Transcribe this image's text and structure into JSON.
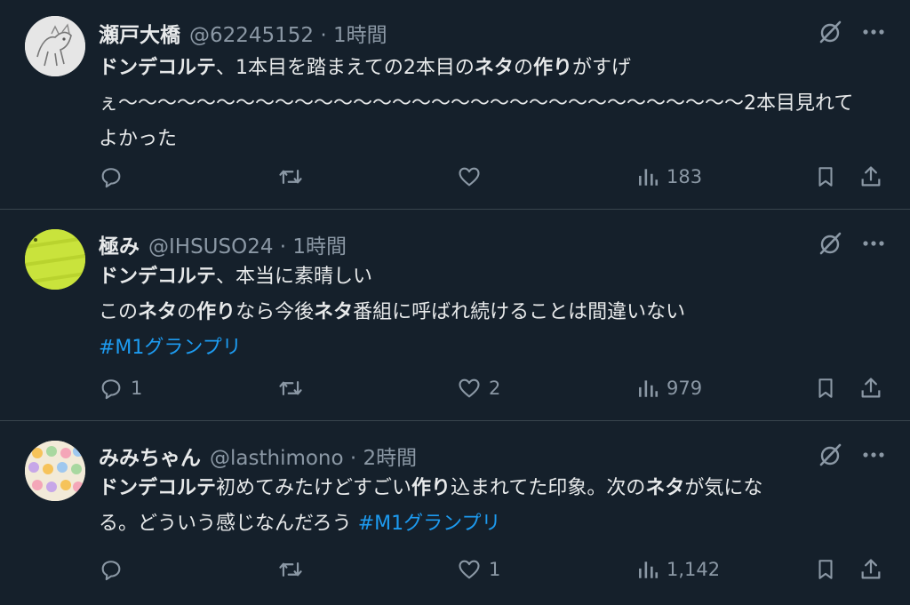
{
  "tweets": [
    {
      "name": "瀬戸大橋",
      "handle": "@62245152",
      "time": "1時間",
      "lines": [
        [
          {
            "t": "ドンデコルテ",
            "b": true
          },
          {
            "t": "、1本目を踏まえての2本目の"
          },
          {
            "t": "ネタ",
            "b": true
          },
          {
            "t": "の"
          },
          {
            "t": "作り",
            "b": true
          },
          {
            "t": "がすげ"
          }
        ],
        [
          {
            "t": "ぇ〜〜〜〜〜〜〜〜〜〜〜〜〜〜〜〜〜〜〜〜〜〜〜〜〜〜〜〜〜〜〜〜2本目見れて"
          }
        ],
        [
          {
            "t": "よかった"
          }
        ]
      ],
      "replies": "",
      "retweets": "",
      "likes": "",
      "views": "183"
    },
    {
      "name": "極み",
      "handle": "@IHSUSO24",
      "time": "1時間",
      "lines": [
        [
          {
            "t": "ドンデコルテ",
            "b": true
          },
          {
            "t": "、本当に素晴しい"
          }
        ],
        [
          {
            "t": "この"
          },
          {
            "t": "ネタ",
            "b": true
          },
          {
            "t": "の"
          },
          {
            "t": "作り",
            "b": true
          },
          {
            "t": "なら今後"
          },
          {
            "t": "ネタ",
            "b": true
          },
          {
            "t": "番組に呼ばれ続けることは間違いない"
          }
        ],
        [
          {
            "t": "#M1グランプリ",
            "tag": true
          }
        ]
      ],
      "replies": "1",
      "retweets": "",
      "likes": "2",
      "views": "979"
    },
    {
      "name": "みみちゃん",
      "handle": "@lasthimono",
      "time": "2時間",
      "lines": [
        [
          {
            "t": "ドンデコルテ",
            "b": true
          },
          {
            "t": "初めてみたけどすごい"
          },
          {
            "t": "作り",
            "b": true
          },
          {
            "t": "込まれてた印象。次の"
          },
          {
            "t": "ネタ",
            "b": true
          },
          {
            "t": "が気にな"
          }
        ],
        [
          {
            "t": "る。どういう感じなんだろう "
          },
          {
            "t": "#M1グランプリ",
            "tag": true
          }
        ]
      ],
      "replies": "",
      "retweets": "",
      "likes": "1",
      "views": "1,142"
    }
  ],
  "icons": {
    "reply": "reply-icon",
    "retweet": "retweet-icon",
    "like": "heart-icon",
    "views": "views-icon",
    "bookmark": "bookmark-icon",
    "share": "share-icon",
    "grok": "grok-icon",
    "more": "more-icon"
  },
  "colors": {
    "background": "#15202b",
    "text": "#e7e9ea",
    "muted": "#8b98a5",
    "link": "#1d9bf0",
    "divider": "#38444d"
  }
}
